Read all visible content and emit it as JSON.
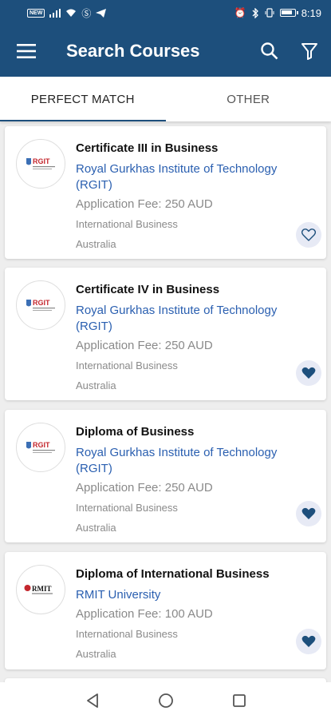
{
  "status_bar": {
    "left_icons": [
      "carrier-badge-icon",
      "signal-icon",
      "wifi-icon",
      "skype-icon",
      "telegram-icon"
    ],
    "right_icons": [
      "alarm-icon",
      "bluetooth-icon",
      "vibrate-icon",
      "battery-icon"
    ],
    "time": "8:19"
  },
  "app_bar": {
    "title": "Search Courses",
    "icons": [
      "menu-icon",
      "search-icon",
      "filter-icon"
    ],
    "color": "#1d4f7c"
  },
  "tabs": [
    {
      "label": "PERFECT MATCH",
      "active": true
    },
    {
      "label": "OTHER",
      "active": false
    }
  ],
  "courses": [
    {
      "title": "Certificate III in Business",
      "institution": "Royal Gurkhas Institute of Technology (RGIT)",
      "fee": "Application Fee: 250 AUD",
      "category": "International Business",
      "country": "Australia",
      "logo": "RGIT",
      "favorited": false
    },
    {
      "title": "Certificate IV in Business",
      "institution": "Royal Gurkhas Institute of Technology (RGIT)",
      "fee": "Application Fee: 250 AUD",
      "category": "International Business",
      "country": "Australia",
      "logo": "RGIT",
      "favorited": true
    },
    {
      "title": "Diploma of Business",
      "institution": "Royal Gurkhas Institute of Technology (RGIT)",
      "fee": "Application Fee: 250 AUD",
      "category": "International Business",
      "country": "Australia",
      "logo": "RGIT",
      "favorited": true
    },
    {
      "title": "Diploma of International Business",
      "institution": "RMIT University",
      "fee": "Application Fee: 100 AUD",
      "category": "International Business",
      "country": "Australia",
      "logo": "RMIT",
      "favorited": true
    }
  ],
  "nav_bar": {
    "icons": [
      "back-icon",
      "home-icon",
      "recents-icon"
    ]
  },
  "colors": {
    "accent": "#1d4f7c",
    "link": "#2a5fb0",
    "fav_bg": "#e7eaf5",
    "fav_icon": "#1d4f7c"
  }
}
